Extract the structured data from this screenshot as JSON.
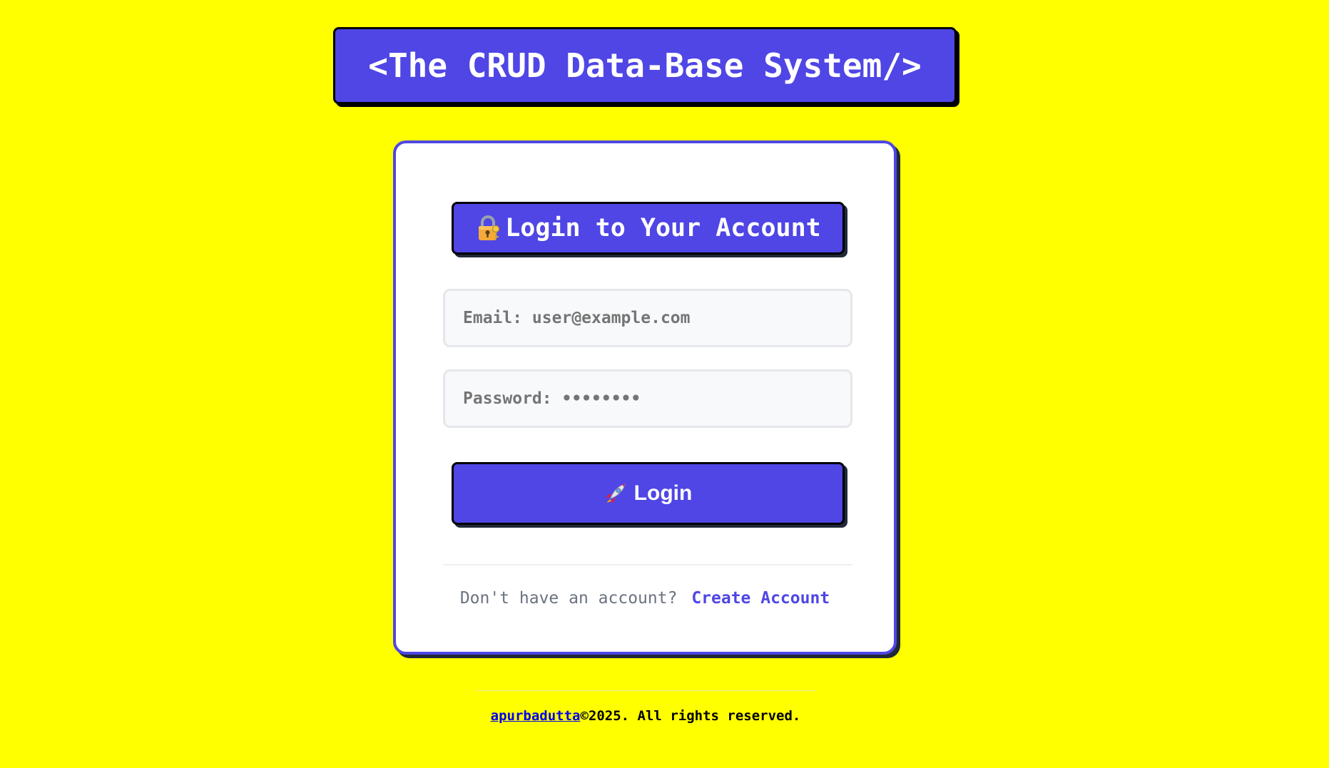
{
  "header": {
    "title": "<The CRUD Data-Base System/>"
  },
  "login_card": {
    "title": "Login to Your Account",
    "title_icon": "lock-with-key-icon",
    "email_field": {
      "placeholder": "Email: user@example.com",
      "value": ""
    },
    "password_field": {
      "placeholder": "Password: ••••••••",
      "value": ""
    },
    "login_button": {
      "label": "Login",
      "icon": "rocket-icon"
    },
    "signup": {
      "prompt": "Don't have an account?",
      "link_label": "Create Account"
    }
  },
  "footer": {
    "author": "apurbadutta",
    "rights": "©2025. All rights reserved."
  },
  "colors": {
    "background": "#ffff00",
    "accent": "#4f46e5",
    "card": "#ffffff",
    "link": "#0000ee"
  }
}
